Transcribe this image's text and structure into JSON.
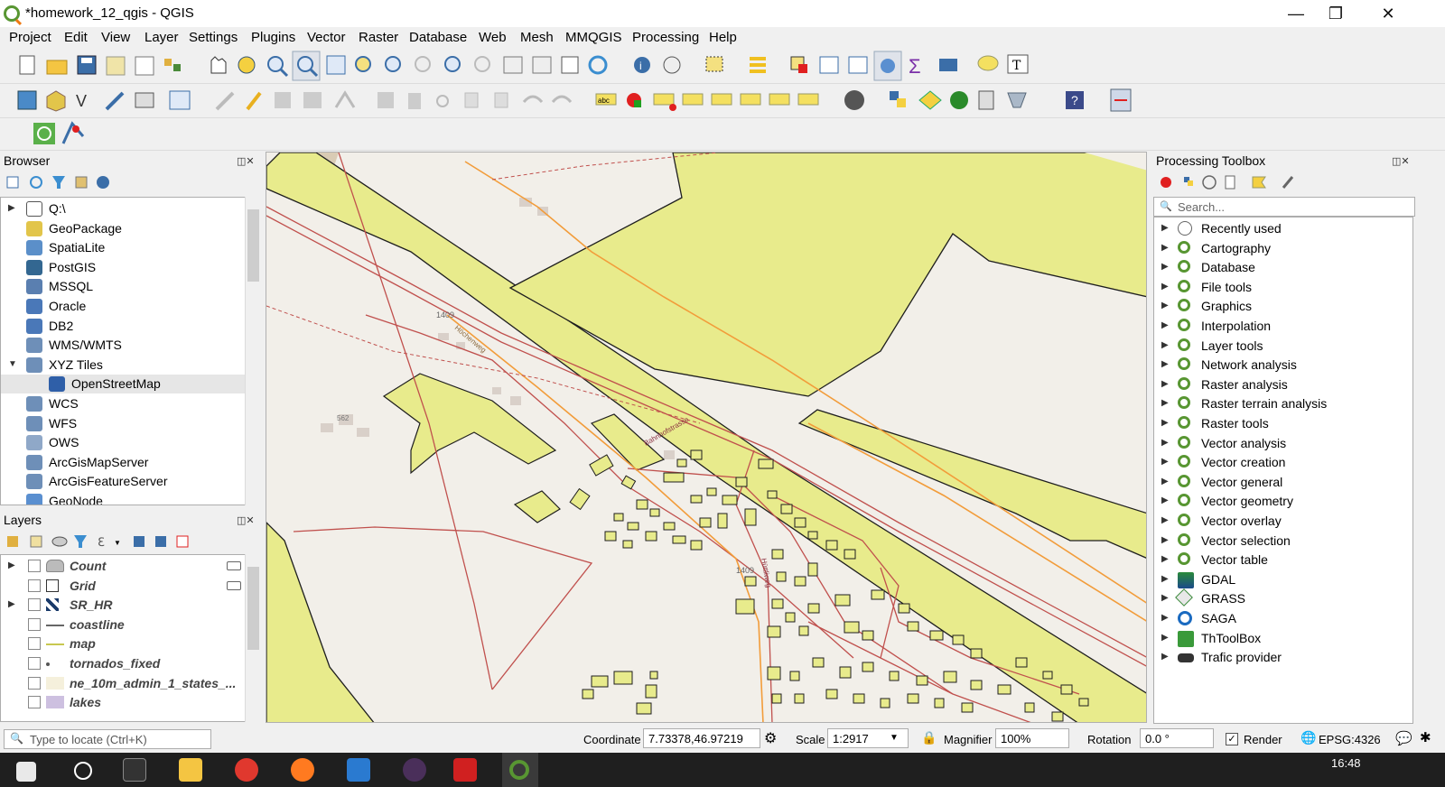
{
  "window": {
    "title": "*homework_12_qgis - QGIS",
    "minimize": "—",
    "maximize": "❐",
    "close": "✕"
  },
  "menu": [
    "Project",
    "Edit",
    "View",
    "Layer",
    "Settings",
    "Plugins",
    "Vector",
    "Raster",
    "Database",
    "Web",
    "Mesh",
    "MMQGIS",
    "Processing",
    "Help"
  ],
  "browser": {
    "title": "Browser",
    "items": [
      {
        "label": "Q:\\",
        "icon": "folder-icon",
        "expand": "▶",
        "color": "#ffffff"
      },
      {
        "label": "GeoPackage",
        "icon": "geopackage-icon",
        "expand": "",
        "color": "#e2c54a"
      },
      {
        "label": "SpatiaLite",
        "icon": "spatialite-icon",
        "expand": "",
        "color": "#5b8fc9"
      },
      {
        "label": "PostGIS",
        "icon": "postgis-icon",
        "expand": "",
        "color": "#336791"
      },
      {
        "label": "MSSQL",
        "icon": "mssql-icon",
        "expand": "",
        "color": "#5a7fb0"
      },
      {
        "label": "Oracle",
        "icon": "oracle-icon",
        "expand": "",
        "color": "#4a78b8"
      },
      {
        "label": "DB2",
        "icon": "db2-icon",
        "expand": "",
        "color": "#4a78b8"
      },
      {
        "label": "WMS/WMTS",
        "icon": "globe-icon",
        "expand": "",
        "color": "#6e8fb8"
      },
      {
        "label": "XYZ Tiles",
        "icon": "globe-icon",
        "expand": "▼",
        "color": "#6e8fb8"
      },
      {
        "label": "OpenStreetMap",
        "icon": "tiles-icon",
        "expand": "",
        "color": "#2f5fa8",
        "indent": true
      },
      {
        "label": "WCS",
        "icon": "globe-icon",
        "expand": "",
        "color": "#6e8fb8"
      },
      {
        "label": "WFS",
        "icon": "wfs-icon",
        "expand": "",
        "color": "#6e8fb8"
      },
      {
        "label": "OWS",
        "icon": "ows-icon",
        "expand": "",
        "color": "#8fa8c8"
      },
      {
        "label": "ArcGisMapServer",
        "icon": "arcgis-icon",
        "expand": "",
        "color": "#6e8fb8"
      },
      {
        "label": "ArcGisFeatureServer",
        "icon": "arcgis-icon",
        "expand": "",
        "color": "#6e8fb8"
      },
      {
        "label": "GeoNode",
        "icon": "geonode-icon",
        "expand": "",
        "color": "#5a8fd0"
      }
    ]
  },
  "layers": {
    "title": "Layers",
    "items": [
      {
        "name": "Count",
        "expand": "▶",
        "sym": "polygon-grey"
      },
      {
        "name": "Grid",
        "expand": "",
        "sym": "square-empty"
      },
      {
        "name": "SR_HR",
        "expand": "▶",
        "sym": "raster"
      },
      {
        "name": "coastline",
        "expand": "",
        "sym": "line-grey"
      },
      {
        "name": "map",
        "expand": "",
        "sym": "line-olive"
      },
      {
        "name": "tornados_fixed",
        "expand": "",
        "sym": "point"
      },
      {
        "name": "ne_10m_admin_1_states_...",
        "expand": "",
        "sym": "fill-cream"
      },
      {
        "name": "lakes",
        "expand": "",
        "sym": "fill-purple"
      }
    ]
  },
  "toolbox": {
    "title": "Processing Toolbox",
    "search_placeholder": "Search...",
    "items": [
      {
        "label": "Recently used",
        "icon": "clock-icon"
      },
      {
        "label": "Cartography",
        "icon": "qgis-icon"
      },
      {
        "label": "Database",
        "icon": "qgis-icon"
      },
      {
        "label": "File tools",
        "icon": "qgis-icon"
      },
      {
        "label": "Graphics",
        "icon": "qgis-icon"
      },
      {
        "label": "Interpolation",
        "icon": "qgis-icon"
      },
      {
        "label": "Layer tools",
        "icon": "qgis-icon"
      },
      {
        "label": "Network analysis",
        "icon": "qgis-icon"
      },
      {
        "label": "Raster analysis",
        "icon": "qgis-icon"
      },
      {
        "label": "Raster terrain analysis",
        "icon": "qgis-icon"
      },
      {
        "label": "Raster tools",
        "icon": "qgis-icon"
      },
      {
        "label": "Vector analysis",
        "icon": "qgis-icon"
      },
      {
        "label": "Vector creation",
        "icon": "qgis-icon"
      },
      {
        "label": "Vector general",
        "icon": "qgis-icon"
      },
      {
        "label": "Vector geometry",
        "icon": "qgis-icon"
      },
      {
        "label": "Vector overlay",
        "icon": "qgis-icon"
      },
      {
        "label": "Vector selection",
        "icon": "qgis-icon"
      },
      {
        "label": "Vector table",
        "icon": "qgis-icon"
      },
      {
        "label": "GDAL",
        "icon": "gdal-icon"
      },
      {
        "label": "GRASS",
        "icon": "grass-icon"
      },
      {
        "label": "SAGA",
        "icon": "saga-icon"
      },
      {
        "label": "ThToolBox",
        "icon": "thtoolbox-icon"
      },
      {
        "label": "Trafic provider",
        "icon": "car-icon"
      }
    ]
  },
  "status": {
    "locate_placeholder": "Type to locate (Ctrl+K)",
    "coordinate_label": "Coordinate",
    "coordinate_value": "7.73378,46.97219",
    "scale_label": "Scale",
    "scale_value": "1:2917",
    "magnifier_label": "Magnifier",
    "magnifier_value": "100%",
    "rotation_label": "Rotation",
    "rotation_value": "0.0 °",
    "render_label": "Render",
    "crs": "EPSG:4326"
  },
  "taskbar": {
    "clock": "16:48"
  },
  "map": {
    "road_labels": [
      "1409",
      "1409",
      "562",
      "Höchenweg",
      "Hüttliweg",
      "Bahnhofstrasse"
    ],
    "colors": {
      "bg": "#f2efe9",
      "feature": "#e8eb8c",
      "feature_outline": "#1e1e1e",
      "road_red": "#c0504d",
      "road_orange": "#f29c3a",
      "building": "#d9d0c9",
      "forest_brown": "#c9b49a"
    }
  }
}
